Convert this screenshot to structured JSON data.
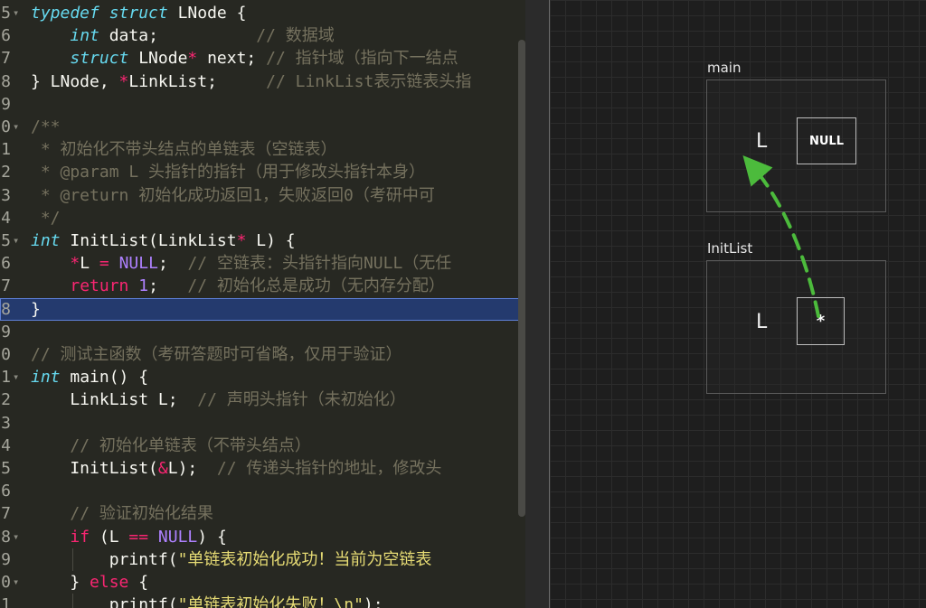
{
  "editor": {
    "active_line": 13,
    "lines": [
      {
        "num": "5",
        "fold": "▾",
        "parts": [
          [
            "kw",
            "typedef "
          ],
          [
            "kw",
            "struct "
          ],
          [
            "pl",
            "LNode {"
          ]
        ]
      },
      {
        "num": "6",
        "fold": "",
        "parts": [
          [
            "pl",
            "    "
          ],
          [
            "kw",
            "int "
          ],
          [
            "pl",
            "data;          "
          ],
          [
            "cm",
            "// 数据域"
          ]
        ]
      },
      {
        "num": "7",
        "fold": "",
        "parts": [
          [
            "pl",
            "    "
          ],
          [
            "kw",
            "struct "
          ],
          [
            "pl",
            "LNode"
          ],
          [
            "op",
            "*"
          ],
          [
            "pl",
            " next; "
          ],
          [
            "cm",
            "// 指针域（指向下一结点"
          ]
        ]
      },
      {
        "num": "8",
        "fold": "",
        "parts": [
          [
            "pl",
            "} LNode, "
          ],
          [
            "op",
            "*"
          ],
          [
            "pl",
            "LinkList;     "
          ],
          [
            "cm",
            "// LinkList表示链表头指"
          ]
        ]
      },
      {
        "num": "9",
        "fold": "",
        "parts": []
      },
      {
        "num": "0",
        "fold": "▾",
        "parts": [
          [
            "cm",
            "/**"
          ]
        ]
      },
      {
        "num": "1",
        "fold": "",
        "parts": [
          [
            "cm",
            " * 初始化不带头结点的单链表（空链表）"
          ]
        ]
      },
      {
        "num": "2",
        "fold": "",
        "parts": [
          [
            "cm",
            " * @param L 头指针的指针（用于修改头指针本身）"
          ]
        ]
      },
      {
        "num": "3",
        "fold": "",
        "parts": [
          [
            "cm",
            " * @return 初始化成功返回1，失败返回0（考研中可"
          ]
        ]
      },
      {
        "num": "4",
        "fold": "",
        "parts": [
          [
            "cm",
            " */"
          ]
        ]
      },
      {
        "num": "5",
        "fold": "▾",
        "parts": [
          [
            "kw",
            "int "
          ],
          [
            "pl",
            "InitList(LinkList"
          ],
          [
            "op",
            "*"
          ],
          [
            "pl",
            " L) {"
          ]
        ]
      },
      {
        "num": "6",
        "fold": "",
        "parts": [
          [
            "pl",
            "    "
          ],
          [
            "op",
            "*"
          ],
          [
            "pl",
            "L "
          ],
          [
            "op",
            "="
          ],
          [
            "pl",
            " "
          ],
          [
            "cn",
            "NULL"
          ],
          [
            "pl",
            ";  "
          ],
          [
            "cm",
            "// 空链表：头指针指向NULL（无任"
          ]
        ]
      },
      {
        "num": "7",
        "fold": "",
        "parts": [
          [
            "pl",
            "    "
          ],
          [
            "kw2",
            "return "
          ],
          [
            "cn",
            "1"
          ],
          [
            "pl",
            ";   "
          ],
          [
            "cm",
            "// 初始化总是成功（无内存分配）"
          ]
        ]
      },
      {
        "num": "8",
        "fold": "",
        "parts": [
          [
            "pl",
            "}"
          ]
        ]
      },
      {
        "num": "9",
        "fold": "",
        "parts": []
      },
      {
        "num": "0",
        "fold": "",
        "parts": [
          [
            "cm",
            "// 测试主函数（考研答题时可省略，仅用于验证）"
          ]
        ]
      },
      {
        "num": "1",
        "fold": "▾",
        "parts": [
          [
            "kw",
            "int "
          ],
          [
            "pl",
            "main() {"
          ]
        ]
      },
      {
        "num": "2",
        "fold": "",
        "parts": [
          [
            "pl",
            "    LinkList L;  "
          ],
          [
            "cm",
            "// 声明头指针（未初始化）"
          ]
        ]
      },
      {
        "num": "3",
        "fold": "",
        "parts": []
      },
      {
        "num": "4",
        "fold": "",
        "parts": [
          [
            "pl",
            "    "
          ],
          [
            "cm",
            "// 初始化单链表（不带头结点）"
          ]
        ]
      },
      {
        "num": "5",
        "fold": "",
        "parts": [
          [
            "pl",
            "    InitList("
          ],
          [
            "op",
            "&"
          ],
          [
            "pl",
            "L);  "
          ],
          [
            "cm",
            "// 传递头指针的地址，修改头"
          ]
        ]
      },
      {
        "num": "6",
        "fold": "",
        "parts": []
      },
      {
        "num": "7",
        "fold": "",
        "parts": [
          [
            "pl",
            "    "
          ],
          [
            "cm",
            "// 验证初始化结果"
          ]
        ]
      },
      {
        "num": "8",
        "fold": "▾",
        "parts": [
          [
            "pl",
            "    "
          ],
          [
            "kw2",
            "if "
          ],
          [
            "pl",
            "(L "
          ],
          [
            "op",
            "=="
          ],
          [
            "pl",
            " "
          ],
          [
            "cn",
            "NULL"
          ],
          [
            "pl",
            ") {"
          ]
        ]
      },
      {
        "num": "9",
        "fold": "",
        "parts": [
          [
            "pl",
            "        printf("
          ],
          [
            "st",
            "\"单链表初始化成功！当前为空链表"
          ]
        ]
      },
      {
        "num": "0",
        "fold": "▾",
        "parts": [
          [
            "pl",
            "    } "
          ],
          [
            "kw2",
            "else "
          ],
          [
            "pl",
            "{"
          ]
        ]
      },
      {
        "num": "1",
        "fold": "",
        "parts": [
          [
            "pl",
            "        printf("
          ],
          [
            "st",
            "\"单链表初始化失败！\\n\""
          ],
          [
            "pl",
            ");"
          ]
        ]
      }
    ]
  },
  "visual": {
    "frames": [
      {
        "key": "main",
        "label": "main",
        "var": "L",
        "cell": "NULL"
      },
      {
        "key": "initlist",
        "label": "InitList",
        "var": "L",
        "cell": "*"
      }
    ],
    "arrow_color": "#4cbb3c"
  }
}
